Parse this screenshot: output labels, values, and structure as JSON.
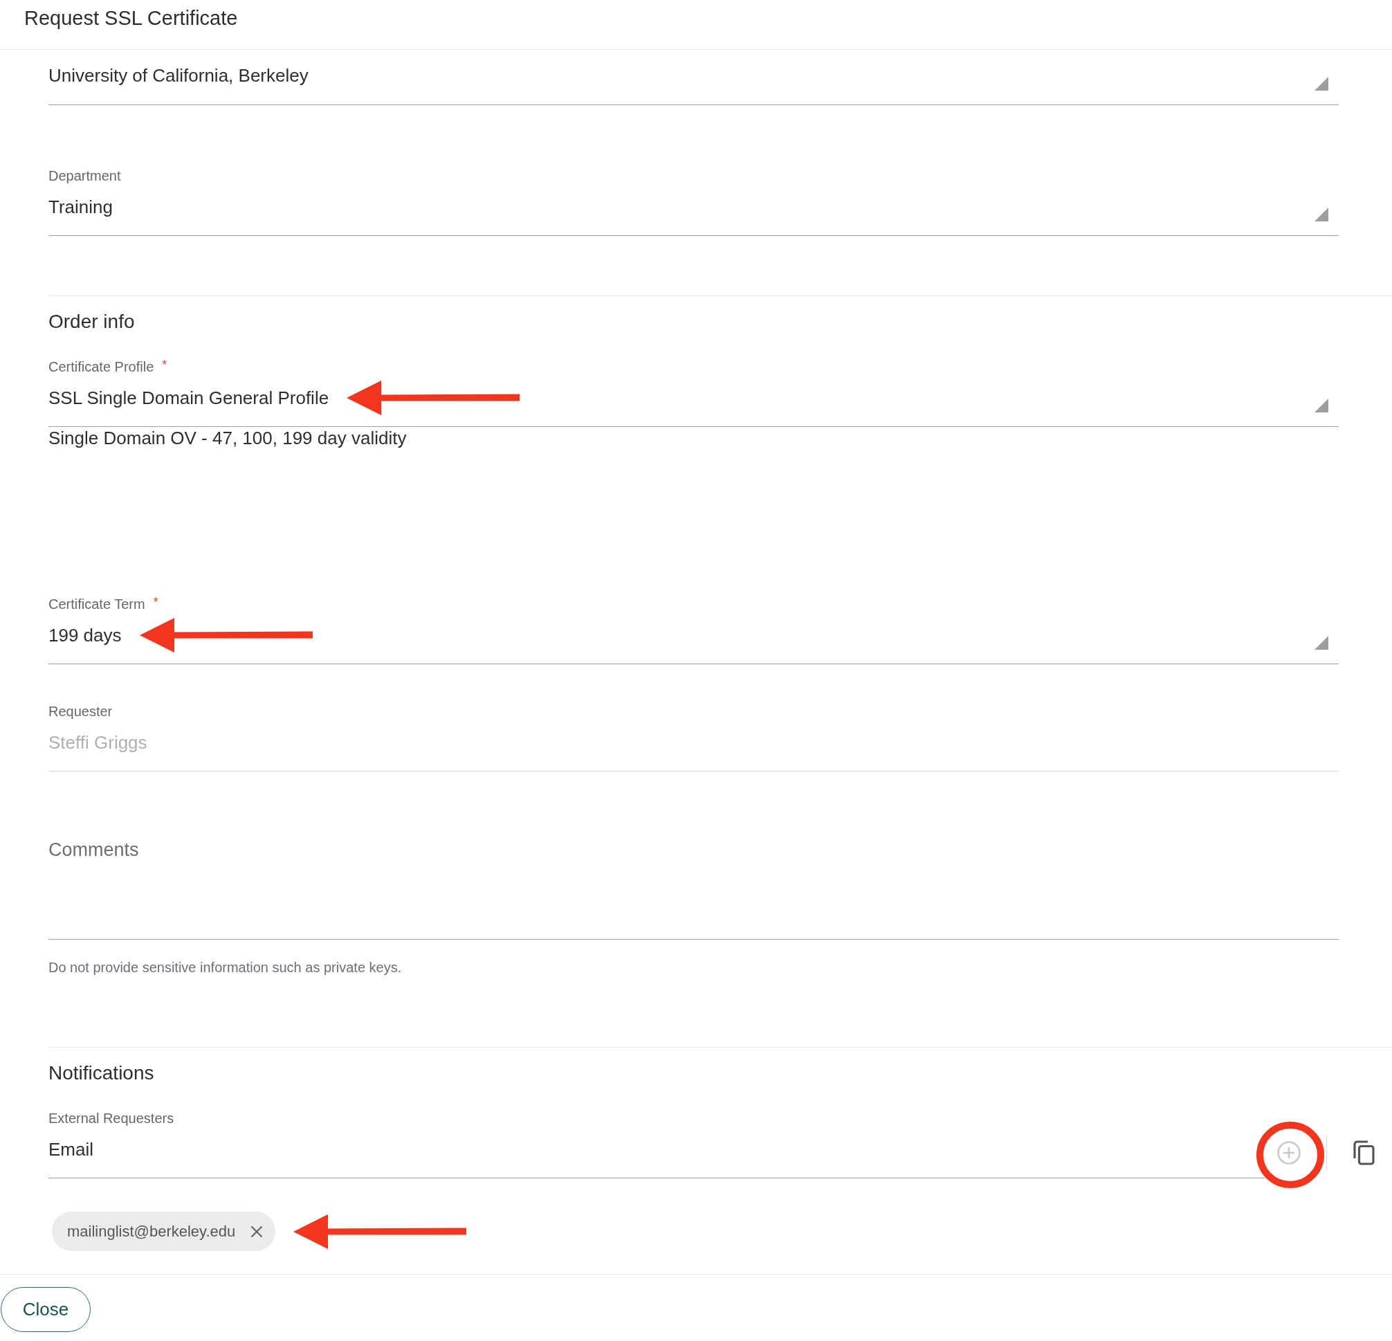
{
  "window": {
    "title": "Request SSL Certificate"
  },
  "sections": [
    {
      "fields": [
        {
          "kind": "select",
          "value": "University of California, Berkeley",
          "disabled": false,
          "annotated": false
        },
        {
          "kind": "select",
          "label": "Department",
          "value": "Training",
          "disabled": false,
          "annotated": false
        }
      ]
    },
    {
      "title": "Order info",
      "fields": [
        {
          "kind": "select",
          "label": "Certificate Profile",
          "required_mark": "*",
          "value": "SSL Single Domain General Profile",
          "annotated": true,
          "description": "Single Domain OV - 47, 100, 199 day validity",
          "disabled": false
        },
        {
          "kind": "select",
          "label": "Certificate Term",
          "required_mark": "*",
          "value": "199 days",
          "annotated": true,
          "disabled": false
        },
        {
          "kind": "text",
          "label": "Requester",
          "value": "Steffi Griggs",
          "disabled": true
        },
        {
          "kind": "textarea",
          "placeholder": "Comments",
          "helper": "Do not provide sensitive information such as private keys.",
          "disabled": false
        }
      ]
    },
    {
      "title": "Notifications",
      "fields": [
        {
          "kind": "email_list",
          "label": "External Requesters",
          "placeholder": "Email",
          "add_circled": true,
          "disabled": false,
          "chips": [
            {
              "text": "mailinglist@berkeley.edu",
              "annotated": true
            }
          ]
        }
      ]
    }
  ],
  "footer": {
    "buttons": [
      "Close"
    ]
  }
}
